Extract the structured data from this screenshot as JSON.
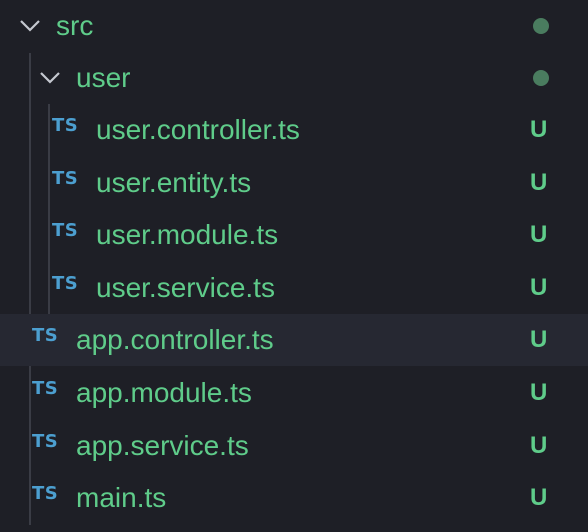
{
  "colors": {
    "background": "#1e1f26",
    "selected_row": "#262832",
    "file_name": "#5fcc8a",
    "ts_badge": "#4c9fd0",
    "modified_dot": "#4a7c5f",
    "guide": "#3a3c45"
  },
  "tree": {
    "root": {
      "label": "src",
      "icon": "chevron-down-icon",
      "state": "expanded",
      "dot": "modified-dot"
    },
    "user_folder": {
      "label": "user",
      "icon": "chevron-down-icon",
      "state": "expanded",
      "dot": "modified-dot",
      "files": [
        {
          "badge": "TS",
          "name": "user.controller.ts",
          "status": "U"
        },
        {
          "badge": "TS",
          "name": "user.entity.ts",
          "status": "U"
        },
        {
          "badge": "TS",
          "name": "user.module.ts",
          "status": "U"
        },
        {
          "badge": "TS",
          "name": "user.service.ts",
          "status": "U"
        }
      ]
    },
    "files": [
      {
        "badge": "TS",
        "name": "app.controller.ts",
        "status": "U",
        "selected": true
      },
      {
        "badge": "TS",
        "name": "app.module.ts",
        "status": "U"
      },
      {
        "badge": "TS",
        "name": "app.service.ts",
        "status": "U"
      },
      {
        "badge": "TS",
        "name": "main.ts",
        "status": "U"
      }
    ]
  }
}
